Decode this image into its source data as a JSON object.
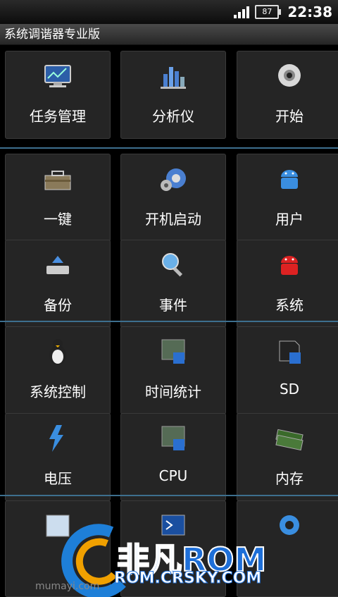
{
  "status": {
    "battery": "87",
    "time": "22:38"
  },
  "title": "系统调谐器专业版",
  "tiles": [
    {
      "label": "任务管理"
    },
    {
      "label": "分析仪"
    },
    {
      "label": "开始"
    },
    {
      "label": "一键"
    },
    {
      "label": "开机启动"
    },
    {
      "label": "用户"
    },
    {
      "label": "备份"
    },
    {
      "label": "事件"
    },
    {
      "label": "系统"
    },
    {
      "label": "系统控制"
    },
    {
      "label": "时间统计"
    },
    {
      "label": "SD"
    },
    {
      "label": "电压"
    },
    {
      "label": "CPU"
    },
    {
      "label": "内存"
    }
  ],
  "watermark": {
    "brand": "非凡ROM",
    "url": "ROM.CRSKY.COM",
    "site": "mumayi.com"
  }
}
